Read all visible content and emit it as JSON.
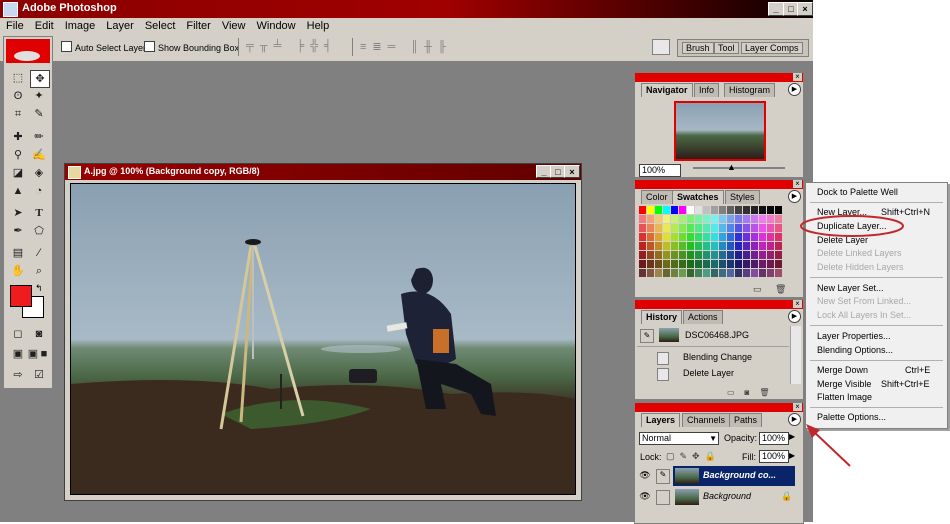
{
  "app": {
    "title": "Adobe Photoshop"
  },
  "menu": [
    "File",
    "Edit",
    "Image",
    "Layer",
    "Select",
    "Filter",
    "View",
    "Window",
    "Help"
  ],
  "options": {
    "auto_select_layer": "Auto Select Layer",
    "show_bounding_box": "Show Bounding Box",
    "wells": [
      "Brush",
      "Tool",
      "Layer Comps"
    ]
  },
  "document": {
    "title": "A.jpg @ 100% (Background copy, RGB/8)"
  },
  "navigator": {
    "tabs": [
      "Navigator",
      "Info",
      "Histogram"
    ],
    "zoom": "100%"
  },
  "swatches": {
    "tabs": [
      "Color",
      "Swatches",
      "Styles"
    ]
  },
  "history": {
    "tabs": [
      "History",
      "Actions"
    ],
    "snapshot": "DSC06468.JPG",
    "items": [
      "Blending Change",
      "Delete Layer"
    ]
  },
  "layers": {
    "tabs": [
      "Layers",
      "Channels",
      "Paths"
    ],
    "blend_mode": "Normal",
    "opacity_label": "Opacity:",
    "opacity": "100%",
    "lock_label": "Lock:",
    "fill_label": "Fill:",
    "fill": "100%",
    "rows": [
      {
        "name": "Background co..."
      },
      {
        "name": "Background"
      }
    ]
  },
  "context_menu": {
    "items": [
      {
        "label": "Dock to Palette Well",
        "shortcut": "",
        "disabled": false
      },
      {
        "label": "New Layer...",
        "shortcut": "Shift+Ctrl+N",
        "disabled": false
      },
      {
        "label": "Duplicate Layer...",
        "shortcut": "",
        "disabled": false
      },
      {
        "label": "Delete Layer",
        "shortcut": "",
        "disabled": false
      },
      {
        "label": "Delete Linked Layers",
        "shortcut": "",
        "disabled": true
      },
      {
        "label": "Delete Hidden Layers",
        "shortcut": "",
        "disabled": true
      },
      {
        "label": "New Layer Set...",
        "shortcut": "",
        "disabled": false
      },
      {
        "label": "New Set From Linked...",
        "shortcut": "",
        "disabled": true
      },
      {
        "label": "Lock All Layers In Set...",
        "shortcut": "",
        "disabled": true
      },
      {
        "label": "Layer Properties...",
        "shortcut": "",
        "disabled": false
      },
      {
        "label": "Blending Options...",
        "shortcut": "",
        "disabled": false
      },
      {
        "label": "Merge Down",
        "shortcut": "Ctrl+E",
        "disabled": false
      },
      {
        "label": "Merge Visible",
        "shortcut": "Shift+Ctrl+E",
        "disabled": false
      },
      {
        "label": "Flatten Image",
        "shortcut": "",
        "disabled": false
      },
      {
        "label": "Palette Options...",
        "shortcut": "",
        "disabled": false
      }
    ]
  },
  "colors": {
    "accent_red": "#e00000",
    "selected_layer": "#0a246a",
    "annotation": "#c0282d"
  }
}
